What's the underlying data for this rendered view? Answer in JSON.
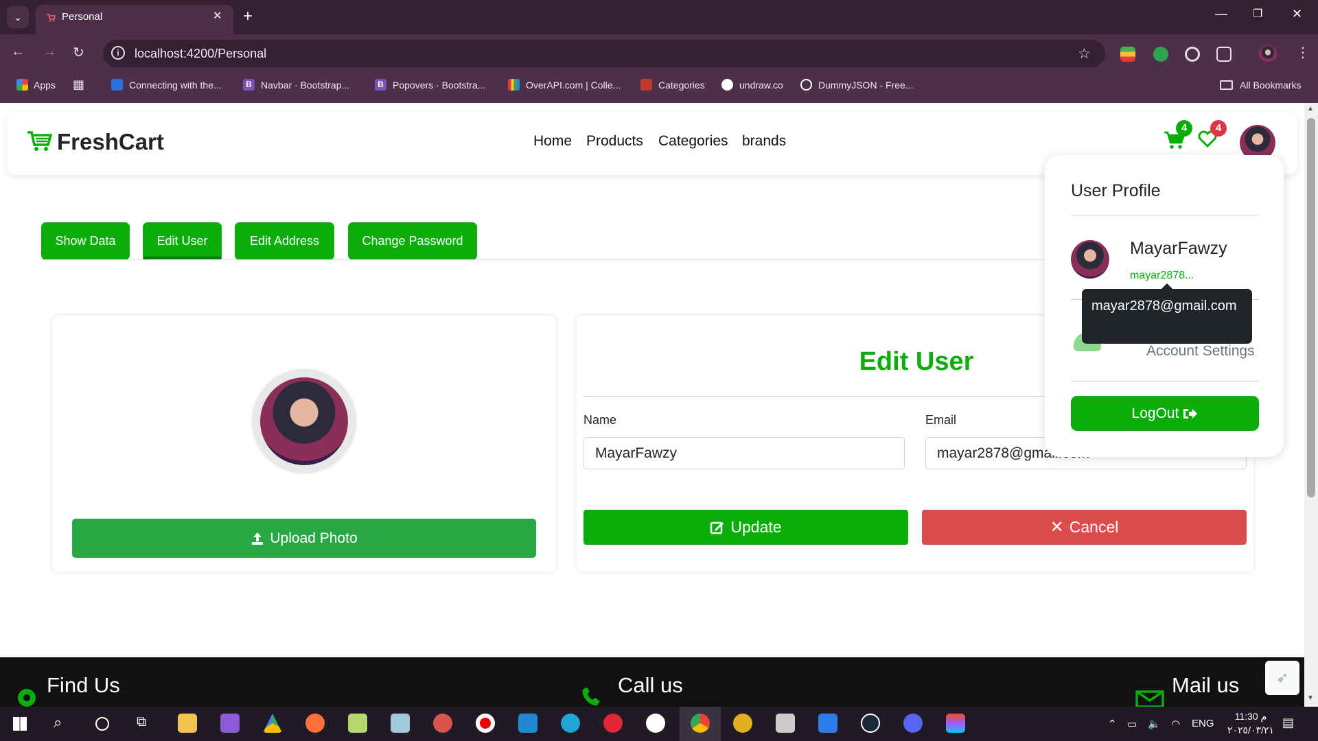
{
  "browser": {
    "tab_title": "Personal",
    "url": "localhost:4200/Personal",
    "bookmarks": [
      "Apps",
      "Connecting with the...",
      "Navbar · Bootstrap...",
      "Popovers · Bootstra...",
      "OverAPI.com | Colle...",
      "Categories",
      "undraw.co",
      "DummyJSON - Free...",
      "All Bookmarks"
    ]
  },
  "navbar": {
    "brand": "FreshCart",
    "links": [
      "Home",
      "Products",
      "Categories",
      "brands"
    ],
    "cart_count": "4",
    "wishlist_count": "4"
  },
  "tabs": [
    "Show Data",
    "Edit User",
    "Edit Address",
    "Change Password"
  ],
  "photo_card": {
    "upload_label": "Upload Photo"
  },
  "form": {
    "title": "Edit User",
    "name_label": "Name",
    "name_value": "MayarFawzy",
    "email_label": "Email",
    "email_value": "mayar2878@gmail.com",
    "update_label": "Update",
    "cancel_label": "Cancel"
  },
  "dropdown": {
    "title": "User Profile",
    "name": "MayarFawzy",
    "email_short": "mayar2878...",
    "tooltip": "mayar2878@gmail.com",
    "settings": "Account Settings",
    "logout": "LogOut"
  },
  "footer": {
    "find_us": "Find Us",
    "call_us": "Call us",
    "mail_us": "Mail us"
  },
  "taskbar": {
    "lang": "ENG",
    "time": "11:30 م",
    "date": "٢٠٢٥/٠٣/٢١"
  },
  "colors": {
    "brand_green": "#0aad0a",
    "danger": "#dc4c4c",
    "chrome": "#4e2f4a"
  }
}
